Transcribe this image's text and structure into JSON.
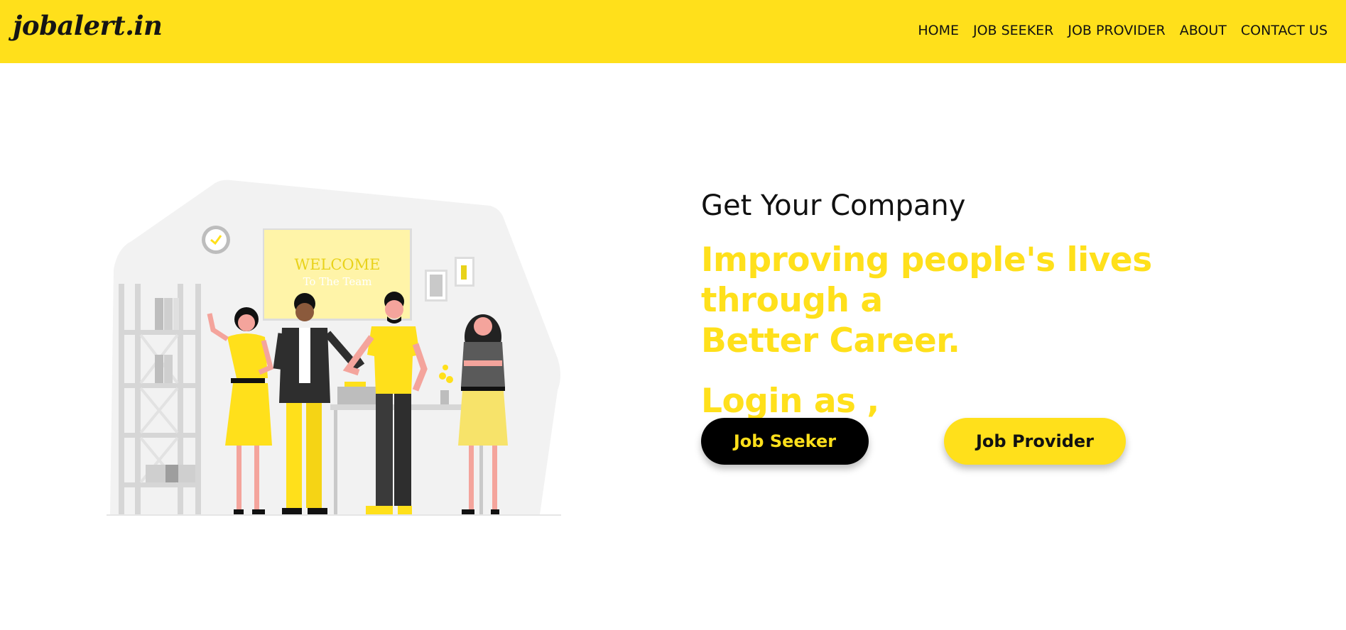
{
  "navbar": {
    "brand": "jobalert.in",
    "links": [
      "HOME",
      "JOB SEEKER",
      "JOB PROVIDER",
      "ABOUT",
      "CONTACT US"
    ]
  },
  "hero": {
    "subtitle": "Get Your Company",
    "headline_line1": "Improving people's lives through a",
    "headline_line2": "Better Career.",
    "login_prompt": "Login as ,",
    "seeker_button": "Job Seeker",
    "provider_button": "Job Provider",
    "illustration": {
      "sign_line1": "WELCOME",
      "sign_line2": "To The Team"
    }
  },
  "colors": {
    "accent": "#FFE01B",
    "dark": "#000000",
    "text": "#111111"
  }
}
